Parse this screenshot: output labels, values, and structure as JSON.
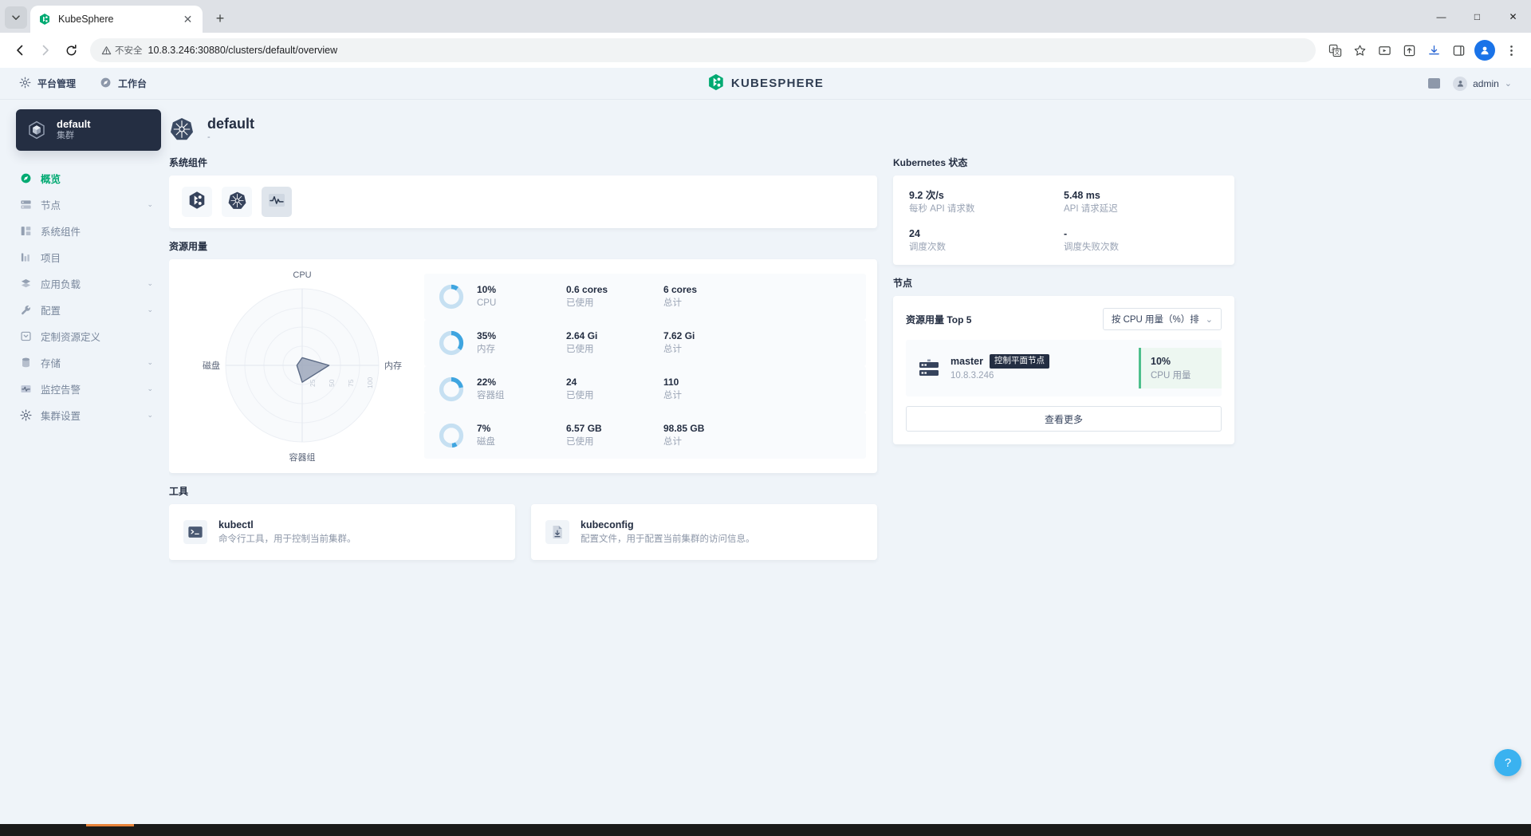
{
  "browser": {
    "tab_title": "KubeSphere",
    "tab_favicon": "kubesphere-icon",
    "new_tab_label": "+",
    "close_label": "✕",
    "back_label": "←",
    "forward_label": "→",
    "reload_label": "⟳",
    "security_label": "不安全",
    "url": "10.8.3.246:30880/clusters/default/overview",
    "minimize_label": "—",
    "maximize_label": "□",
    "close_window_label": "✕",
    "avatar_initial": "●"
  },
  "header": {
    "nav": [
      {
        "label": "平台管理",
        "icon": "gear-icon"
      },
      {
        "label": "工作台",
        "icon": "compass-icon"
      }
    ],
    "logo_text": "KUBESPHERE",
    "user": "admin",
    "user_chevron": "⌄"
  },
  "sidebar": {
    "cluster": {
      "name": "default",
      "type": "集群",
      "icon": "cube-icon"
    },
    "items": [
      {
        "label": "概览",
        "icon": "compass-icon",
        "active": true,
        "expandable": false
      },
      {
        "label": "节点",
        "icon": "server-icon",
        "active": false,
        "expandable": true
      },
      {
        "label": "系统组件",
        "icon": "components-icon",
        "active": false,
        "expandable": false
      },
      {
        "label": "项目",
        "icon": "project-icon",
        "active": false,
        "expandable": false
      },
      {
        "label": "应用负载",
        "icon": "layers-icon",
        "active": false,
        "expandable": true
      },
      {
        "label": "配置",
        "icon": "wrench-icon",
        "active": false,
        "expandable": true
      },
      {
        "label": "定制资源定义",
        "icon": "crd-icon",
        "active": false,
        "expandable": false
      },
      {
        "label": "存储",
        "icon": "database-icon",
        "active": false,
        "expandable": true
      },
      {
        "label": "监控告警",
        "icon": "monitor-icon",
        "active": false,
        "expandable": true
      },
      {
        "label": "集群设置",
        "icon": "gear-icon",
        "active": false,
        "expandable": true
      }
    ],
    "chevron": "⌄"
  },
  "page": {
    "title": "default",
    "subtitle": "-",
    "icon": "kubernetes-icon"
  },
  "components_section": {
    "title": "系统组件",
    "tiles": [
      {
        "name": "kubesphere-component-icon"
      },
      {
        "name": "kubernetes-component-icon"
      },
      {
        "name": "monitoring-component-icon"
      }
    ]
  },
  "resource_section": {
    "title": "资源用量",
    "rows": [
      {
        "percent": "10%",
        "name": "CPU",
        "used": "0.6 cores",
        "used_label": "已使用",
        "total": "6 cores",
        "total_label": "总计",
        "value": 10
      },
      {
        "percent": "35%",
        "name": "内存",
        "used": "2.64 Gi",
        "used_label": "已使用",
        "total": "7.62 Gi",
        "total_label": "总计",
        "value": 35
      },
      {
        "percent": "22%",
        "name": "容器组",
        "used": "24",
        "used_label": "已使用",
        "total": "110",
        "total_label": "总计",
        "value": 22
      },
      {
        "percent": "7%",
        "name": "磁盘",
        "used": "6.57 GB",
        "used_label": "已使用",
        "total": "98.85 GB",
        "total_label": "总计",
        "value": 7
      }
    ]
  },
  "chart_data": {
    "type": "radar",
    "title": "",
    "axes": [
      "CPU",
      "内存",
      "容器组",
      "磁盘"
    ],
    "values": [
      10,
      35,
      22,
      7
    ],
    "tick_labels": [
      "25",
      "50",
      "75",
      "100"
    ],
    "rmax": 100,
    "fill_color": "#9aa5b8",
    "stroke_color": "#5b6a85",
    "grid": true,
    "legend": "none"
  },
  "tools_section": {
    "title": "工具",
    "items": [
      {
        "name": "kubectl",
        "desc": "命令行工具，用于控制当前集群。",
        "icon": "terminal-icon"
      },
      {
        "name": "kubeconfig",
        "desc": "配置文件，用于配置当前集群的访问信息。",
        "icon": "download-file-icon"
      }
    ]
  },
  "k8s_status": {
    "title": "Kubernetes 状态",
    "items": [
      {
        "value": "9.2 次/s",
        "label": "每秒 API 请求数"
      },
      {
        "value": "5.48 ms",
        "label": "API 请求延迟"
      },
      {
        "value": "24",
        "label": "调度次数"
      },
      {
        "value": "-",
        "label": "调度失败次数"
      }
    ]
  },
  "nodes_section": {
    "title": "节点",
    "panel_title": "资源用量 Top 5",
    "sort_label": "按 CPU 用量（%）排",
    "sort_chevron": "⌄",
    "rows": [
      {
        "name": "master",
        "badge": "控制平面节点",
        "ip": "10.8.3.246",
        "metric_value": "10%",
        "metric_label": "CPU 用量"
      }
    ],
    "view_more": "查看更多"
  },
  "fab": {
    "label": "?"
  },
  "colors": {
    "accent_green": "#00aa72",
    "dark_navy": "#242e42",
    "donut_blue": "#3fa5e0",
    "donut_track": "#c6e0f2",
    "node_green": "#4ebf8c",
    "page_bg": "#eff4f9"
  }
}
